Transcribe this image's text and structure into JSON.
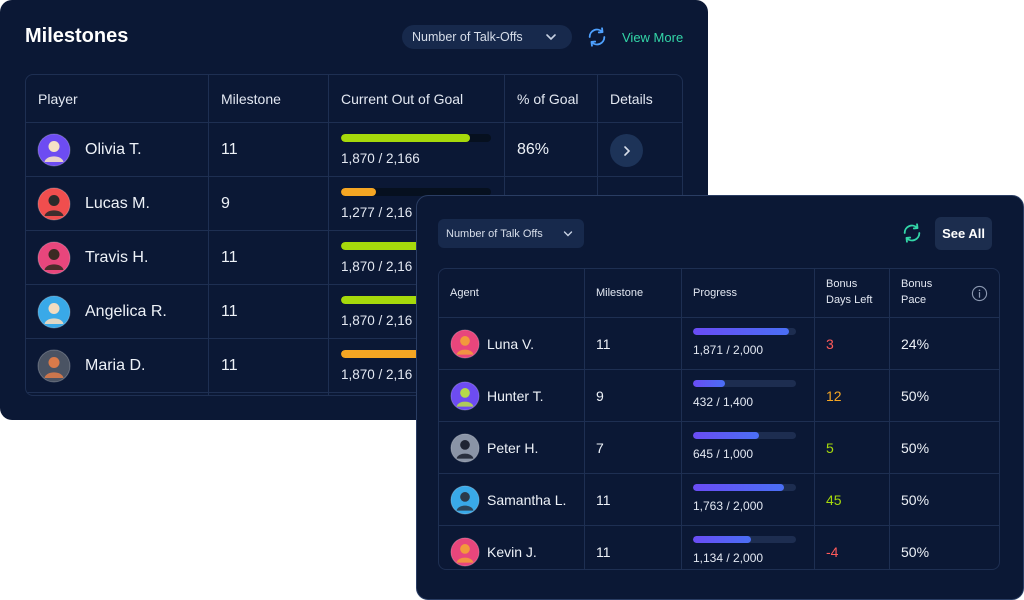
{
  "milestones": {
    "title": "Milestones",
    "dropdown_value": "Number of Talk-Offs",
    "view_more_label": "View More",
    "icons": {
      "dropdown": "chevron-down-icon",
      "refresh": "refresh-icon",
      "details": "chevron-right-icon"
    },
    "columns": [
      "Player",
      "Milestone",
      "Current Out of Goal",
      "% of Goal",
      "Details"
    ],
    "rows": [
      {
        "player": "Olivia T.",
        "milestone": "11",
        "current": "1,870 / 2,166",
        "progress": 0.86,
        "bar_color": "#a6d90b",
        "pct": "86%",
        "avatar_bg": "#6d4cf2",
        "avatar_fg": "#f4e1c6"
      },
      {
        "player": "Lucas M.",
        "milestone": "9",
        "current": "1,277 / 2,16",
        "progress": 0.23,
        "bar_color": "#f5a623",
        "pct": "",
        "avatar_bg": "#f04e4e",
        "avatar_fg": "#2b2b2b"
      },
      {
        "player": "Travis H.",
        "milestone": "11",
        "current": "1,870 / 2,16",
        "progress": 0.86,
        "bar_color": "#a6d90b",
        "pct": "",
        "avatar_bg": "#e8467c",
        "avatar_fg": "#3a2a22"
      },
      {
        "player": "Angelica R.",
        "milestone": "11",
        "current": "1,870 / 2,16",
        "progress": 0.86,
        "bar_color": "#a6d90b",
        "pct": "",
        "avatar_bg": "#39a9e8",
        "avatar_fg": "#f3dcc0"
      },
      {
        "player": "Maria D.",
        "milestone": "11",
        "current": "1,870 / 2,16",
        "progress": 0.86,
        "bar_color": "#f5a623",
        "pct": "",
        "avatar_bg": "#4a5363",
        "avatar_fg": "#d97a4a"
      }
    ]
  },
  "agents_panel": {
    "dropdown_value": "Number of Talk Offs",
    "see_all_label": "See All",
    "icons": {
      "dropdown": "chevron-down-icon",
      "refresh": "refresh-icon",
      "info": "info-icon"
    },
    "columns": {
      "agent": "Agent",
      "milestone": "Milestone",
      "progress": "Progress",
      "days_line1": "Bonus",
      "days_line2": "Days Left",
      "pace_line1": "Bonus",
      "pace_line2": "Pace"
    },
    "rows": [
      {
        "agent": "Luna V.",
        "milestone": "11",
        "progress_text": "1,871 / 2,000",
        "progress": 0.9355,
        "days_left": "3",
        "days_color": "#ff5a5a",
        "pace": "24%",
        "avatar_bg": "#e8467c",
        "avatar_fg": "#f29a3c"
      },
      {
        "agent": "Hunter T.",
        "milestone": "9",
        "progress_text": "432 / 1,400",
        "progress": 0.3086,
        "days_left": "12",
        "days_color": "#f5a623",
        "pace": "50%",
        "avatar_bg": "#6d4cf2",
        "avatar_fg": "#b6d94a"
      },
      {
        "agent": "Peter H.",
        "milestone": "7",
        "progress_text": "645 / 1,000",
        "progress": 0.645,
        "days_left": "5",
        "days_color": "#a6d90b",
        "pace": "50%",
        "avatar_bg": "#8a94a6",
        "avatar_fg": "#1e2433"
      },
      {
        "agent": "Samantha L.",
        "milestone": "11",
        "progress_text": "1,763 / 2,000",
        "progress": 0.8815,
        "days_left": "45",
        "days_color": "#a6d90b",
        "pace": "50%",
        "avatar_bg": "#39a9e8",
        "avatar_fg": "#2b3a4a"
      },
      {
        "agent": "Kevin J.",
        "milestone": "11",
        "progress_text": "1,134 / 2,000",
        "progress": 0.567,
        "days_left": "-4",
        "days_color": "#ff5a5a",
        "pace": "50%",
        "avatar_bg": "#e8467c",
        "avatar_fg": "#f29a3c"
      }
    ]
  }
}
